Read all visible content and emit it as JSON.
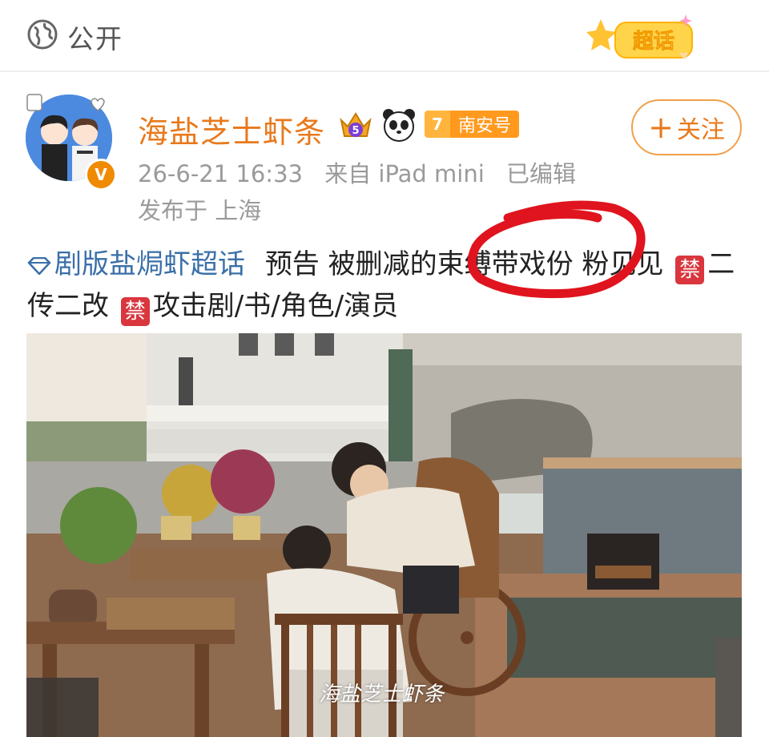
{
  "topbar": {
    "visibility_label": "公开",
    "supertopic_badge": "超话",
    "globe_icon": "globe-icon"
  },
  "post": {
    "author": {
      "username": "海盐芝士虾条",
      "verified_badge": "V",
      "crown_level": "5",
      "account_tag_level": "7",
      "account_tag_name": "南安号"
    },
    "follow_label": "关注",
    "follow_plus": "+",
    "timestamp": "26-6-21 16:33",
    "source": "来自 iPad mini",
    "edited": "已编辑",
    "location": "发布于 上海",
    "topic": "剧版盐焗虾超话",
    "text_part1": "预告 被删减的束缚带戏份 粉见见",
    "ban_glyph": "禁",
    "text_part2": "二传二改",
    "text_part3": "攻击剧/书/角色/演员",
    "image_watermark": "海盐芝士虾条"
  },
  "colors": {
    "accent_orange": "#e8791c",
    "link_blue": "#3a6fa8",
    "annotation_red": "#e0141e",
    "ban_red": "#d9363e"
  }
}
